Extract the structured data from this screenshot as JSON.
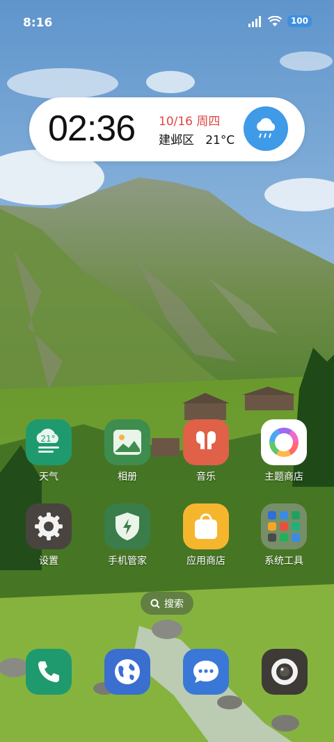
{
  "status_bar": {
    "time": "8:16",
    "battery": "100",
    "icons": [
      "signal-icon",
      "wifi-icon",
      "battery-icon"
    ]
  },
  "clock_widget": {
    "time": "02:36",
    "date": "10/16 周四",
    "location": "建邺区",
    "temperature": "21°C",
    "weather_icon": "rain-cloud-icon",
    "date_color": "#e04444",
    "badge_color": "#3f9ae8"
  },
  "apps": [
    {
      "label": "天气",
      "icon": "weather-app-icon",
      "icon_text": "21°",
      "color": "#1f9a6e"
    },
    {
      "label": "相册",
      "icon": "gallery-app-icon",
      "color": "#3f8c4f"
    },
    {
      "label": "音乐",
      "icon": "music-app-icon",
      "color": "#e06048"
    },
    {
      "label": "主题商店",
      "icon": "theme-store-icon",
      "color": "#ffffff"
    },
    {
      "label": "设置",
      "icon": "settings-gear-icon",
      "color": "#4a4440"
    },
    {
      "label": "手机管家",
      "icon": "security-shield-icon",
      "color": "#3a7d4a"
    },
    {
      "label": "应用商店",
      "icon": "app-store-bag-icon",
      "color": "#f5b62e"
    },
    {
      "label": "系统工具",
      "icon": "system-tools-folder-icon",
      "color": "#8a9a8a"
    }
  ],
  "search": {
    "label": "搜索",
    "icon": "search-icon"
  },
  "dock": [
    {
      "icon": "phone-icon",
      "color": "#1f9a6e"
    },
    {
      "icon": "browser-globe-icon",
      "color": "#3a6fd0"
    },
    {
      "icon": "messages-icon",
      "color": "#3a78d8"
    },
    {
      "icon": "camera-icon",
      "color": "#3e3a36"
    }
  ]
}
